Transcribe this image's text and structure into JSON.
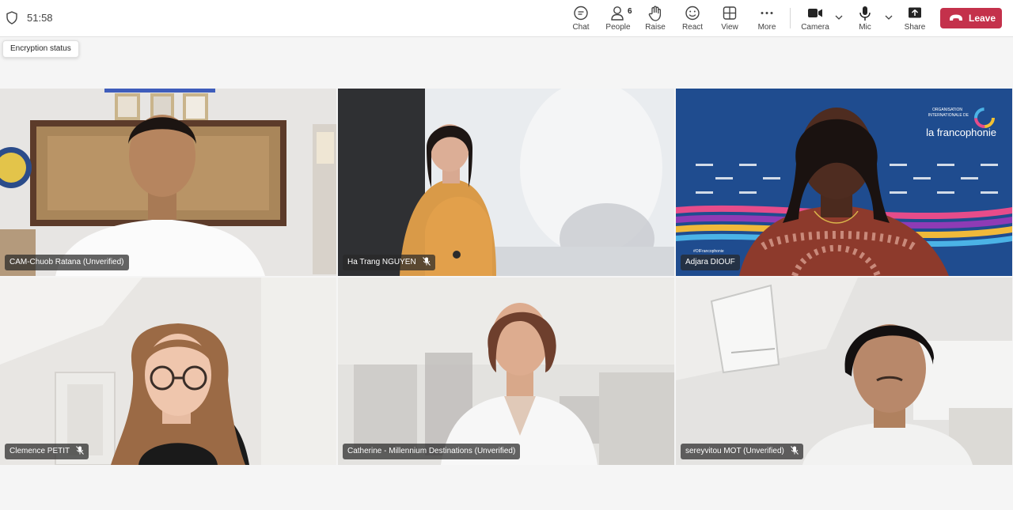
{
  "call": {
    "timer": "51:58"
  },
  "tooltip": {
    "text": "Encryption status"
  },
  "toolbar": {
    "chat": "Chat",
    "people": "People",
    "people_count": "6",
    "raise": "Raise",
    "react": "React",
    "view": "View",
    "more": "More",
    "camera": "Camera",
    "mic": "Mic",
    "share": "Share",
    "leave": "Leave"
  },
  "colors": {
    "leave": "#c4314b",
    "background": "#f5f5f5"
  },
  "participants": [
    {
      "name": "CAM-Chuob Ratana (Unverified)"
    },
    {
      "name": "Ha Trang NGUYEN"
    },
    {
      "name": "Adjara DIOUF"
    },
    {
      "name": "Clemence PETIT"
    },
    {
      "name": "Catherine - Millennium Destinations (Unverified)"
    },
    {
      "name": "sereyvitou MOT (Unverified)"
    }
  ],
  "backdrop": {
    "line1": "ORGANISATION",
    "line2": "INTERNATIONALE DE",
    "brand": "la francophonie",
    "handle": "#OIFrancophonie"
  }
}
